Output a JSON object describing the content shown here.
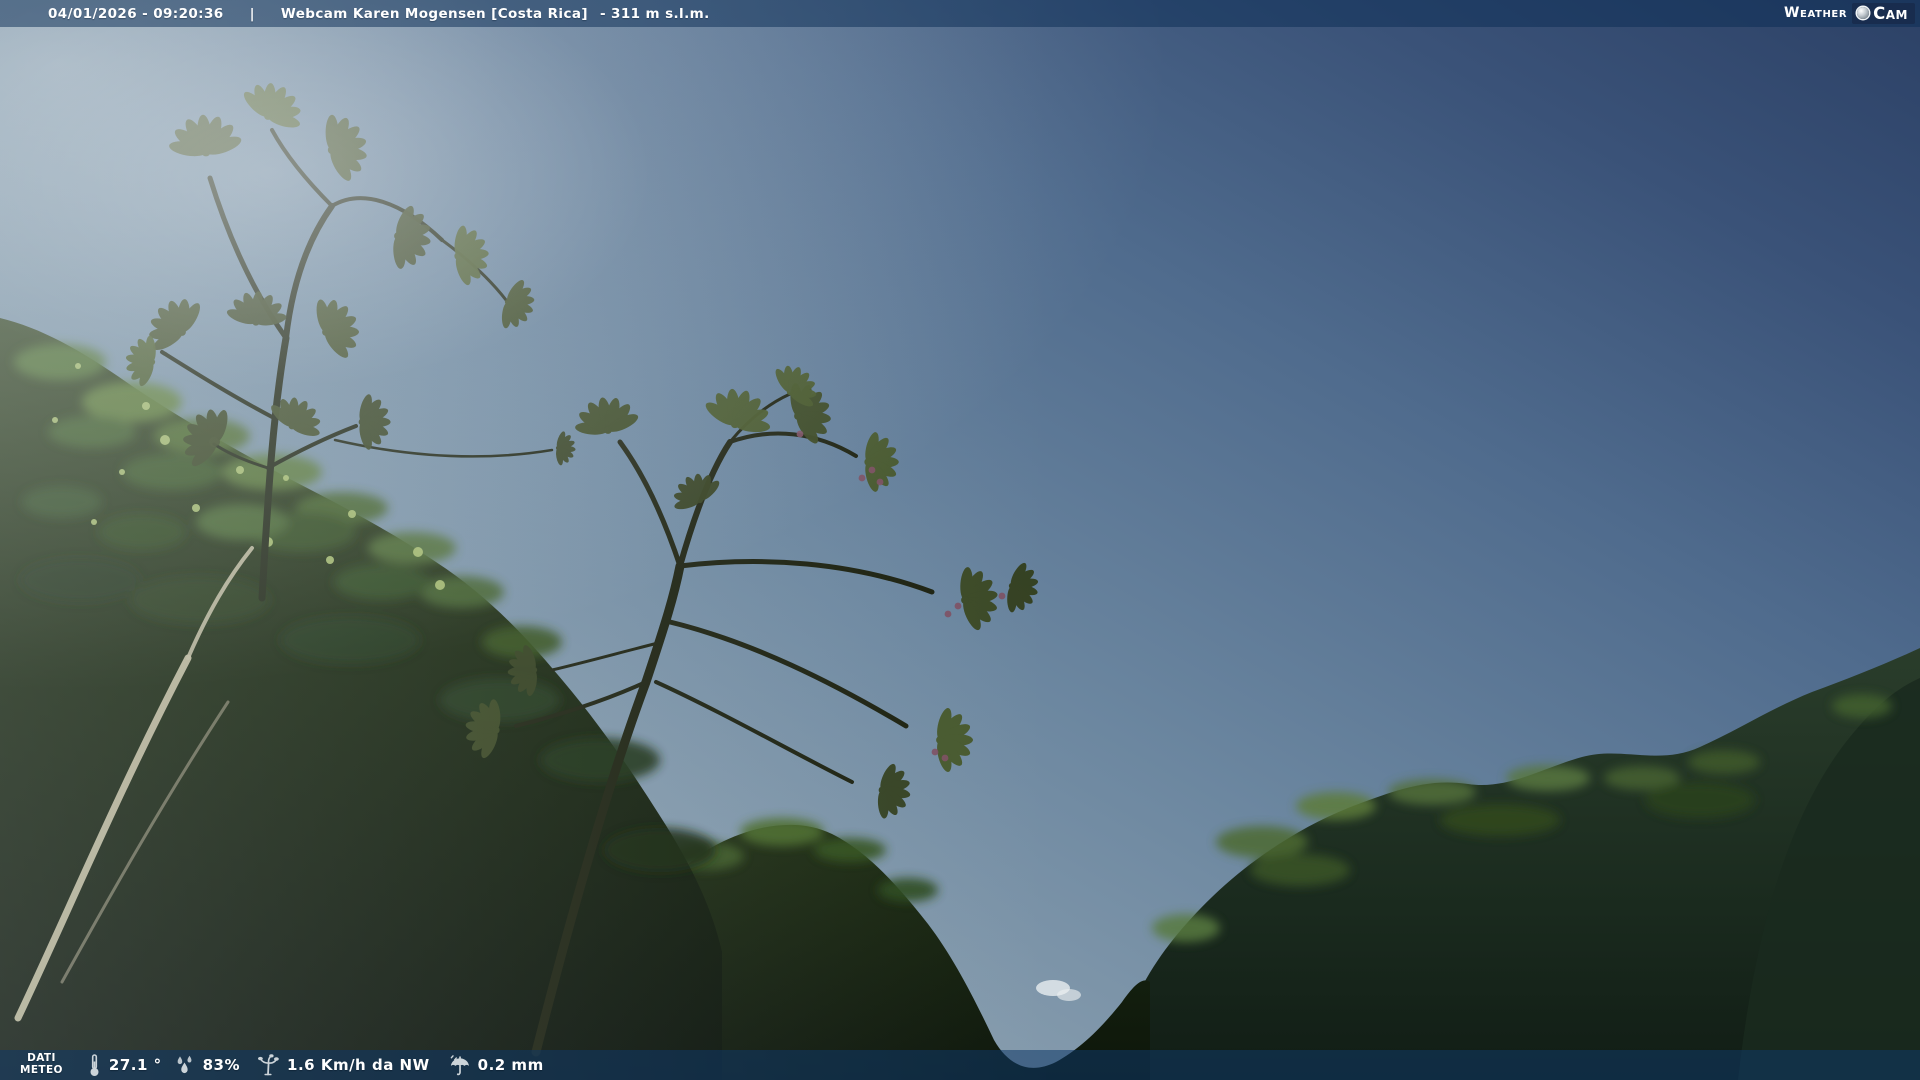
{
  "top_bar": {
    "datetime": "04/01/2026 - 09:20:36",
    "separator": "|",
    "webcam_title": "Webcam Karen Mogensen [Costa Rica]",
    "elevation": "- 311 m s.l.m."
  },
  "logo": {
    "weather": "Weather",
    "cam": "Cam"
  },
  "bottom_bar": {
    "label_line1": "DATI",
    "label_line2": "METEO",
    "temperature": {
      "icon": "thermometer-icon",
      "value": "27.1 °"
    },
    "humidity": {
      "icon": "humidity-drops-icon",
      "value": "83%"
    },
    "wind": {
      "icon": "anemometer-icon",
      "value": "1.6 Km/h da NW"
    },
    "rain": {
      "icon": "umbrella-rain-icon",
      "value": "0.2 mm"
    }
  },
  "colors": {
    "overlay_bar": "#0a2c54",
    "bottom_overlay": "#0e3868",
    "logo_badge": "#182c4e",
    "sky_top_right": "#2c4166",
    "sky_bottom_left": "#a5b6bd",
    "text": "#ffffff"
  }
}
